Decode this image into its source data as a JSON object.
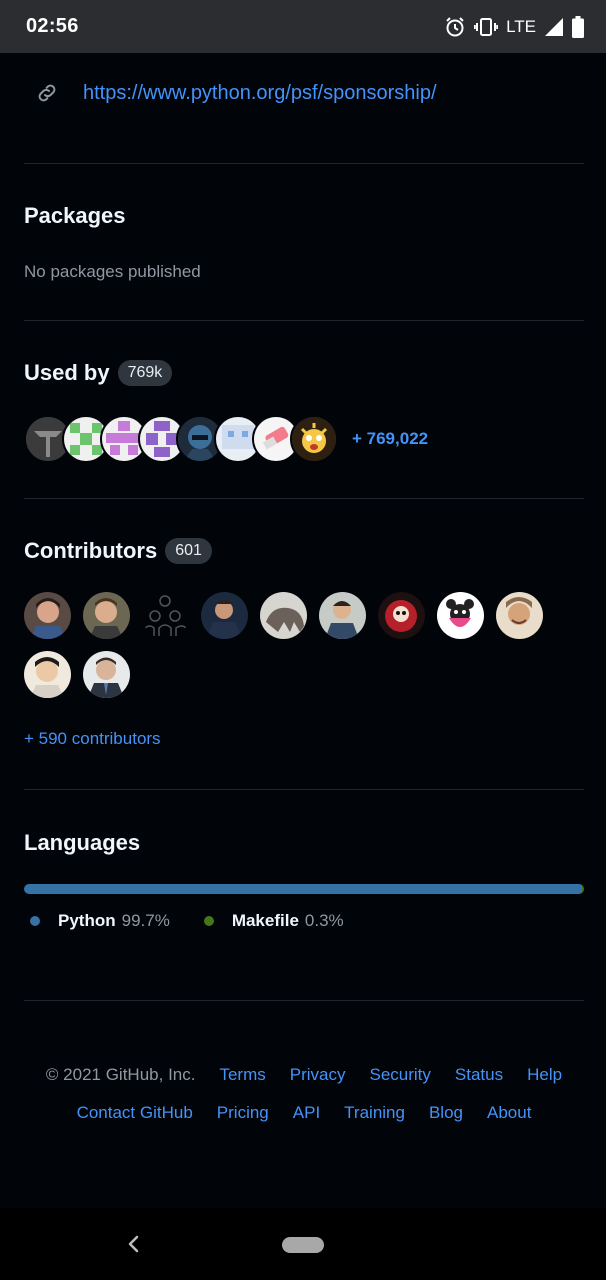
{
  "status_bar": {
    "time": "02:56",
    "network": "LTE"
  },
  "link": {
    "url": "https://www.python.org/psf/sponsorship/",
    "icon": "link-icon"
  },
  "packages": {
    "title": "Packages",
    "empty_text": "No packages published"
  },
  "used_by": {
    "title": "Used by",
    "count_badge": "769k",
    "more_text": "+ 769,022"
  },
  "contributors": {
    "title": "Contributors",
    "count_badge": "601",
    "more_link": "+ 590 contributors"
  },
  "languages": {
    "title": "Languages",
    "items": [
      {
        "name": "Python",
        "percent": "99.7%",
        "value": 99.7,
        "color": "#3572A5"
      },
      {
        "name": "Makefile",
        "percent": "0.3%",
        "value": 0.3,
        "color": "#427819"
      }
    ]
  },
  "footer": {
    "copyright": "© 2021 GitHub, Inc.",
    "links_row1": [
      "Terms",
      "Privacy",
      "Security",
      "Status",
      "Help"
    ],
    "links_row2": [
      "Contact GitHub",
      "Pricing",
      "API",
      "Training",
      "Blog",
      "About"
    ]
  },
  "colors": {
    "accent": "#4493f8",
    "background": "#010409",
    "muted": "#9198a1"
  }
}
